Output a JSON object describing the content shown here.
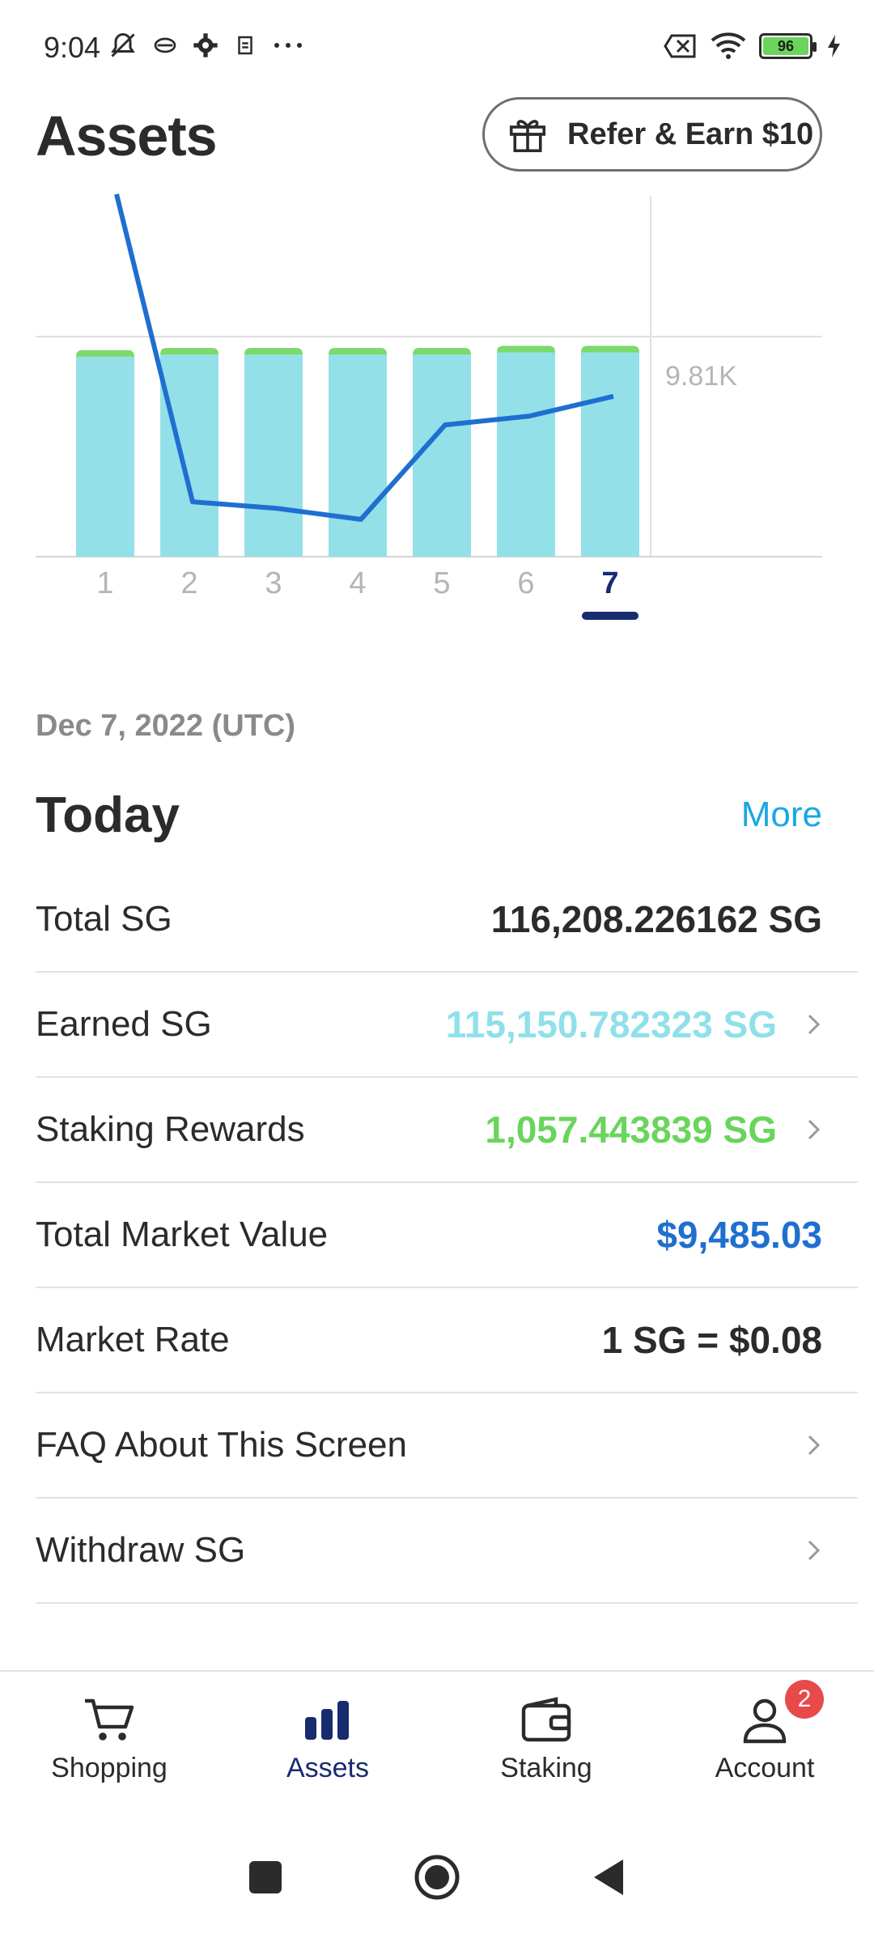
{
  "status_bar": {
    "time": "9:04",
    "battery_level": "96",
    "left_icons": [
      "bell-off-icon",
      "sync-icon",
      "gear-icon",
      "app-icon",
      "more-dots-icon"
    ],
    "right_icons": [
      "sim-off-icon",
      "wifi-icon",
      "battery-icon",
      "charging-icon"
    ]
  },
  "header": {
    "title": "Assets",
    "refer_button": {
      "label": "Refer & Earn $10",
      "icon": "gift-icon"
    }
  },
  "chart_data": {
    "type": "bar",
    "categories": [
      "1",
      "2",
      "3",
      "4",
      "5",
      "6",
      "7"
    ],
    "series": [
      {
        "type": "bar",
        "values": [
          9.1,
          9.2,
          9.2,
          9.2,
          9.2,
          9.3,
          9.3
        ],
        "color": "#94e0e8"
      },
      {
        "type": "bar",
        "values": [
          0.3,
          0.3,
          0.3,
          0.3,
          0.3,
          0.3,
          0.3
        ],
        "color": "#7cd96a"
      },
      {
        "type": "line",
        "values": [
          16.5,
          2.5,
          2.2,
          1.7,
          6.0,
          6.4,
          7.3
        ],
        "color": "#1f6fd1"
      }
    ],
    "y_tick_label": "9.81K",
    "ylim": [
      0,
      16.5
    ],
    "selected_index": 6,
    "grid": true
  },
  "date_label": "Dec 7, 2022 (UTC)",
  "today": {
    "title": "Today",
    "more_label": "More"
  },
  "rows": [
    {
      "label": "Total SG",
      "value": "116,208.226162 SG",
      "value_color": "dark",
      "chevron": false
    },
    {
      "label": "Earned SG",
      "value": "115,150.782323 SG",
      "value_color": "cyan",
      "chevron": true
    },
    {
      "label": "Staking Rewards",
      "value": "1,057.443839 SG",
      "value_color": "green",
      "chevron": true
    },
    {
      "label": "Total Market Value",
      "value": "$9,485.03",
      "value_color": "blue",
      "chevron": false
    },
    {
      "label": "Market Rate",
      "value": "1 SG = $0.08",
      "value_color": "dark",
      "chevron": false
    },
    {
      "label": "FAQ About This Screen",
      "value": "",
      "value_color": "dark",
      "chevron": true
    },
    {
      "label": "Withdraw SG",
      "value": "",
      "value_color": "dark",
      "chevron": true
    }
  ],
  "bottom_nav": [
    {
      "label": "Shopping",
      "icon": "cart-icon",
      "active": false
    },
    {
      "label": "Assets",
      "icon": "bar-chart-icon",
      "active": true
    },
    {
      "label": "Staking",
      "icon": "wallet-icon",
      "active": false
    },
    {
      "label": "Account",
      "icon": "user-icon",
      "active": false,
      "badge": "2"
    }
  ],
  "colors": {
    "accent_blue": "#1f6fd1",
    "accent_cyan": "#8fe0ea",
    "accent_green": "#6ad45c",
    "navy": "#172b6f",
    "more_link": "#19a7e8"
  }
}
